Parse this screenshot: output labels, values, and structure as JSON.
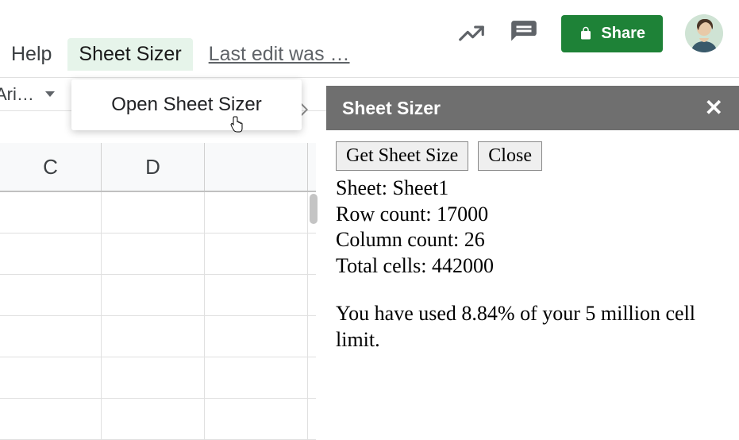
{
  "menu": {
    "help": "Help",
    "sheet_sizer": "Sheet Sizer",
    "last_edit": "Last edit was …"
  },
  "toolbar": {
    "font_truncated": "Ari…"
  },
  "dropdown": {
    "open_label": "Open Sheet Sizer"
  },
  "share": {
    "label": "Share"
  },
  "columns": [
    "C",
    "D"
  ],
  "sidebar": {
    "title": "Sheet Sizer",
    "buttons": {
      "get_size": "Get Sheet Size",
      "close": "Close"
    },
    "info": {
      "sheet_label": "Sheet:",
      "sheet_name": "Sheet1",
      "row_label": "Row count:",
      "row_count": "17000",
      "col_label": "Column count:",
      "col_count": "26",
      "total_label": "Total cells:",
      "total_cells": "442000"
    },
    "usage": "You have used 8.84% of your 5 million cell limit."
  }
}
